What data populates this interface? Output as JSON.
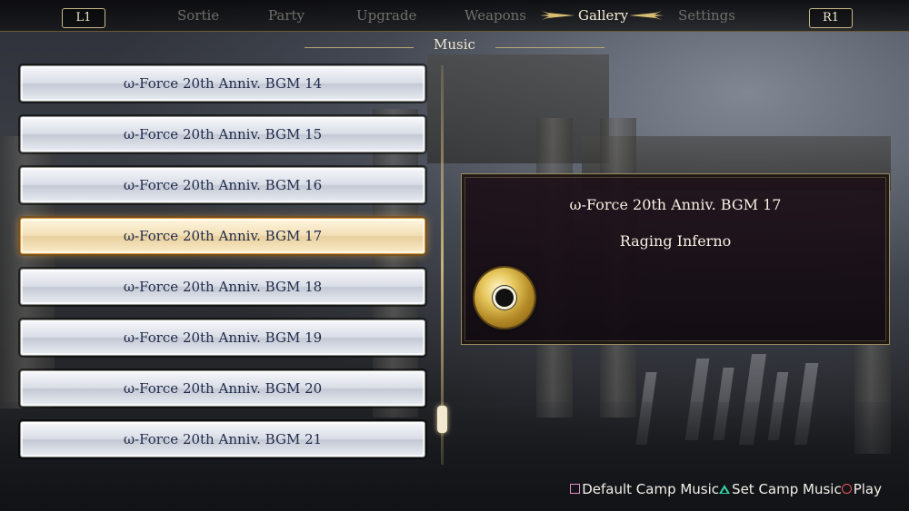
{
  "top_bar": {
    "left_shoulder": "L1",
    "right_shoulder": "R1",
    "tabs": [
      {
        "label": "Sortie",
        "active": false
      },
      {
        "label": "Party",
        "active": false
      },
      {
        "label": "Upgrade",
        "active": false
      },
      {
        "label": "Weapons",
        "active": false
      },
      {
        "label": "Gallery",
        "active": true
      },
      {
        "label": "Settings",
        "active": false
      }
    ]
  },
  "section_title": "Music",
  "music_list": [
    {
      "label": "ω-Force 20th Anniv. BGM 14",
      "selected": false
    },
    {
      "label": "ω-Force 20th Anniv. BGM 15",
      "selected": false
    },
    {
      "label": "ω-Force 20th Anniv. BGM 16",
      "selected": false
    },
    {
      "label": "ω-Force 20th Anniv. BGM 17",
      "selected": true
    },
    {
      "label": "ω-Force 20th Anniv. BGM 18",
      "selected": false
    },
    {
      "label": "ω-Force 20th Anniv. BGM 19",
      "selected": false
    },
    {
      "label": "ω-Force 20th Anniv. BGM 20",
      "selected": false
    },
    {
      "label": "ω-Force 20th Anniv. BGM 21",
      "selected": false
    }
  ],
  "detail": {
    "title": "ω-Force 20th Anniv. BGM 17",
    "track_name": "Raging Inferno",
    "icon": "music-disc-icon"
  },
  "footer": {
    "hints": [
      {
        "icon": "square-button-icon",
        "label": "Default Camp Music"
      },
      {
        "icon": "triangle-button-icon",
        "label": "Set Camp Music"
      },
      {
        "icon": "circle-button-icon",
        "label": "Play"
      }
    ]
  },
  "colors": {
    "accent_gold": "#c8b88a",
    "selected_item": "#f2dfb6",
    "item_text": "#1f2a4a",
    "panel_bg": "#1e1018"
  }
}
